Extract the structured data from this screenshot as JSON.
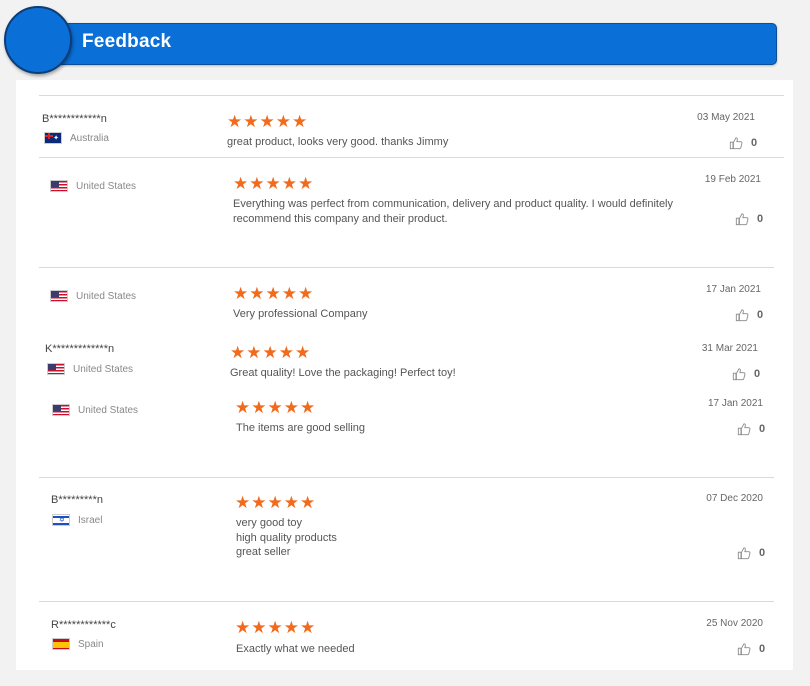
{
  "header": {
    "title": "Feedback"
  },
  "colors": {
    "accent": "#0a6fd6",
    "star": "#f26b1d"
  },
  "reviews": [
    {
      "name": "B************n",
      "country": "Australia",
      "flag": "au",
      "stars": "★★★★★",
      "rating": 5,
      "text": "great product, looks very good. thanks Jimmy",
      "date": "03 May 2021",
      "likes": "0"
    },
    {
      "name": "",
      "country": "United States",
      "flag": "us",
      "stars": "★★★★★",
      "rating": 5,
      "text": "Everything was perfect from communication, delivery and product quality.  I would definitely recommend this company and their product.",
      "date": "19 Feb 2021",
      "likes": "0"
    },
    {
      "name": "",
      "country": "United States",
      "flag": "us",
      "stars": "★★★★★",
      "rating": 5,
      "text": "Very professional Company",
      "date": "17 Jan 2021",
      "likes": "0"
    },
    {
      "name": "K*************n",
      "country": "United States",
      "flag": "us",
      "stars": "★★★★★",
      "rating": 5,
      "text": "Great quality! Love the packaging! Perfect toy!",
      "date": "31 Mar 2021",
      "likes": "0"
    },
    {
      "name": "",
      "country": "United States",
      "flag": "us",
      "stars": "★★★★★",
      "rating": 5,
      "text": "The items are good selling",
      "date": "17 Jan 2021",
      "likes": "0"
    },
    {
      "name": "B*********n",
      "country": "Israel",
      "flag": "il",
      "stars": "★★★★★",
      "rating": 5,
      "text": "very good toy\nhigh quality products\ngreat seller",
      "date": "07 Dec 2020",
      "likes": "0"
    },
    {
      "name": "R************c",
      "country": "Spain",
      "flag": "es",
      "stars": "★★★★★",
      "rating": 5,
      "text": "Exactly what we needed",
      "date": "25 Nov 2020",
      "likes": "0"
    }
  ]
}
